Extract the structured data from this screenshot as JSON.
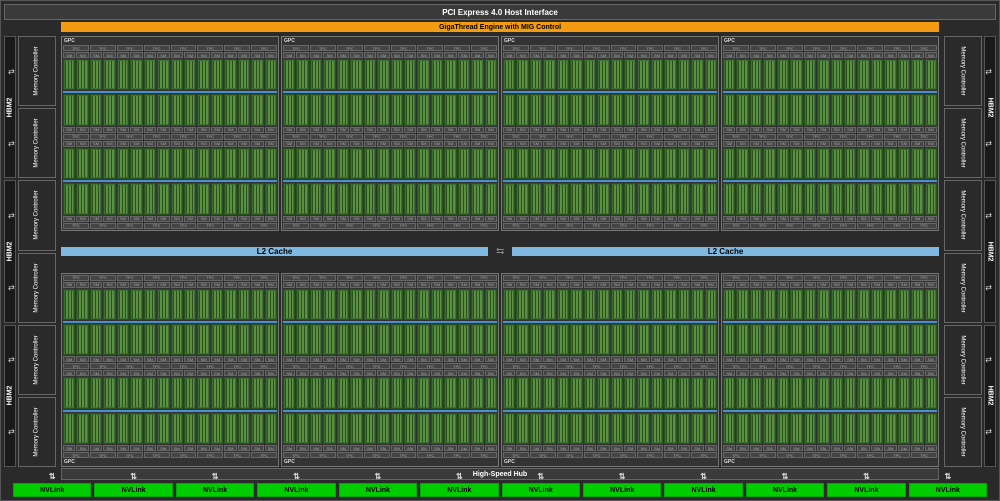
{
  "labels": {
    "pcie": "PCI Express 4.0 Host Interface",
    "giga": "GigaThread Engine with MIG Control",
    "hshub": "High-Speed Hub",
    "l2": "L2 Cache",
    "hbm": "HBM2",
    "mc": "Memory Controller",
    "gpc": "GPC",
    "tpc": "TPC",
    "sm": "SM",
    "nvlink": "NVLink"
  },
  "architecture": {
    "gpc_count": 8,
    "tpc_per_gpc": 8,
    "sm_per_tpc": 2,
    "hbm_stacks": 6,
    "memory_controllers": 12,
    "nvlinks": 12,
    "l2_slices": 2
  }
}
